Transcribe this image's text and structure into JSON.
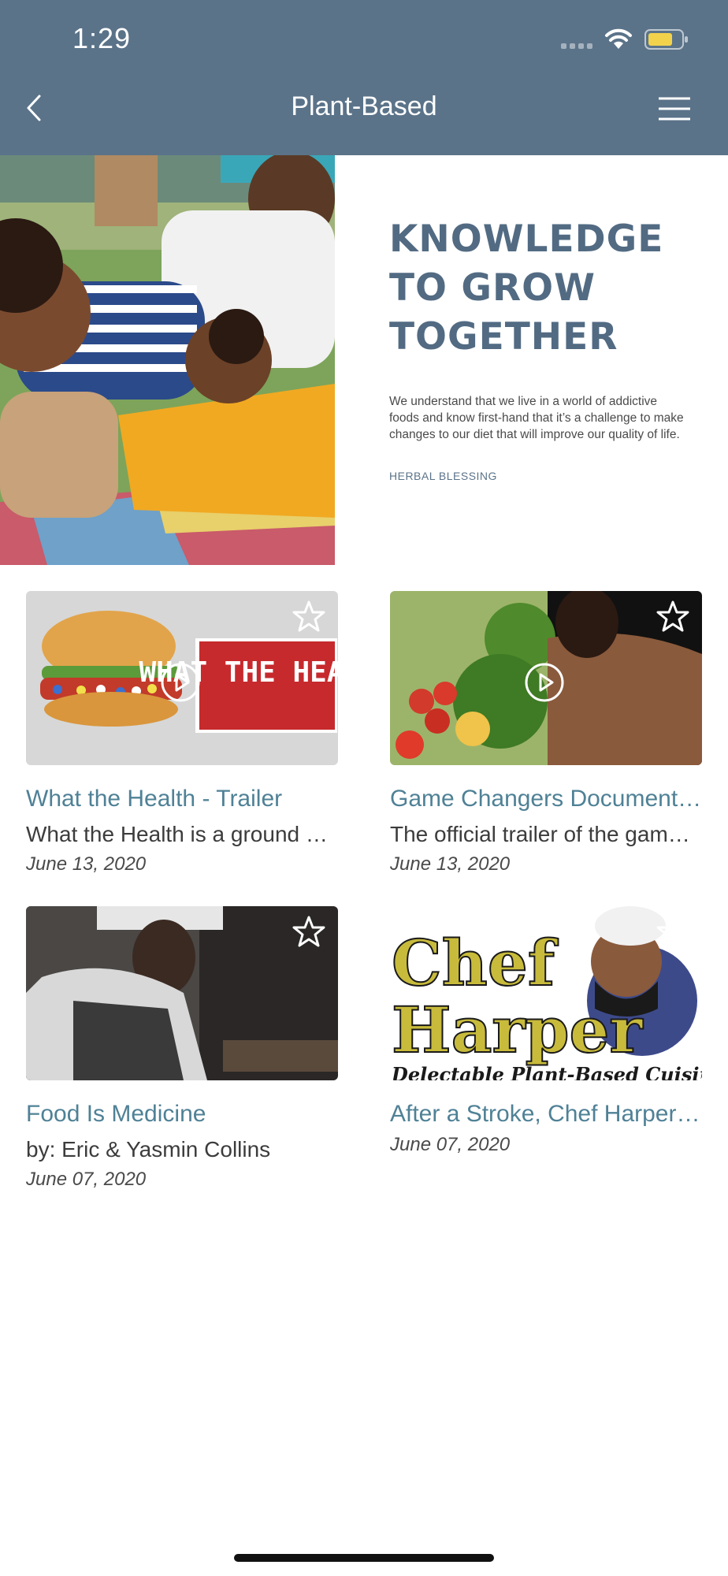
{
  "status_bar": {
    "time": "1:29"
  },
  "header": {
    "title": "Plant-Based"
  },
  "hero": {
    "heading": "KNOWLEDGE TO GROW TOGETHER",
    "description": "We understand that we live in a world of addictive foods and know first-hand that it’s a challenge to make changes to our diet that will improve our quality of life.",
    "brand": "HERBAL BLESSING"
  },
  "cards": [
    {
      "title": "What the Health - Trailer",
      "description": "What the Health is a ground …",
      "date": "June 13, 2020",
      "thumb_text": "WHAT THE HEALTH"
    },
    {
      "title": "Game Changers Document…",
      "description": "The official trailer of the gam…",
      "date": "June 13, 2020"
    },
    {
      "title": "Food Is Medicine",
      "description": "by: Eric & Yasmin Collins",
      "date": "June 07, 2020"
    },
    {
      "title": "After a Stroke, Chef Harper…",
      "description": "",
      "date": "June 07, 2020",
      "thumb_text_1": "Chef",
      "thumb_text_2": "Harper",
      "thumb_text_3": "Delectable Plant-Based Cuisine"
    }
  ],
  "colors": {
    "header": "#5b7389",
    "accent_title": "#4f8196",
    "heading": "#526b83"
  }
}
